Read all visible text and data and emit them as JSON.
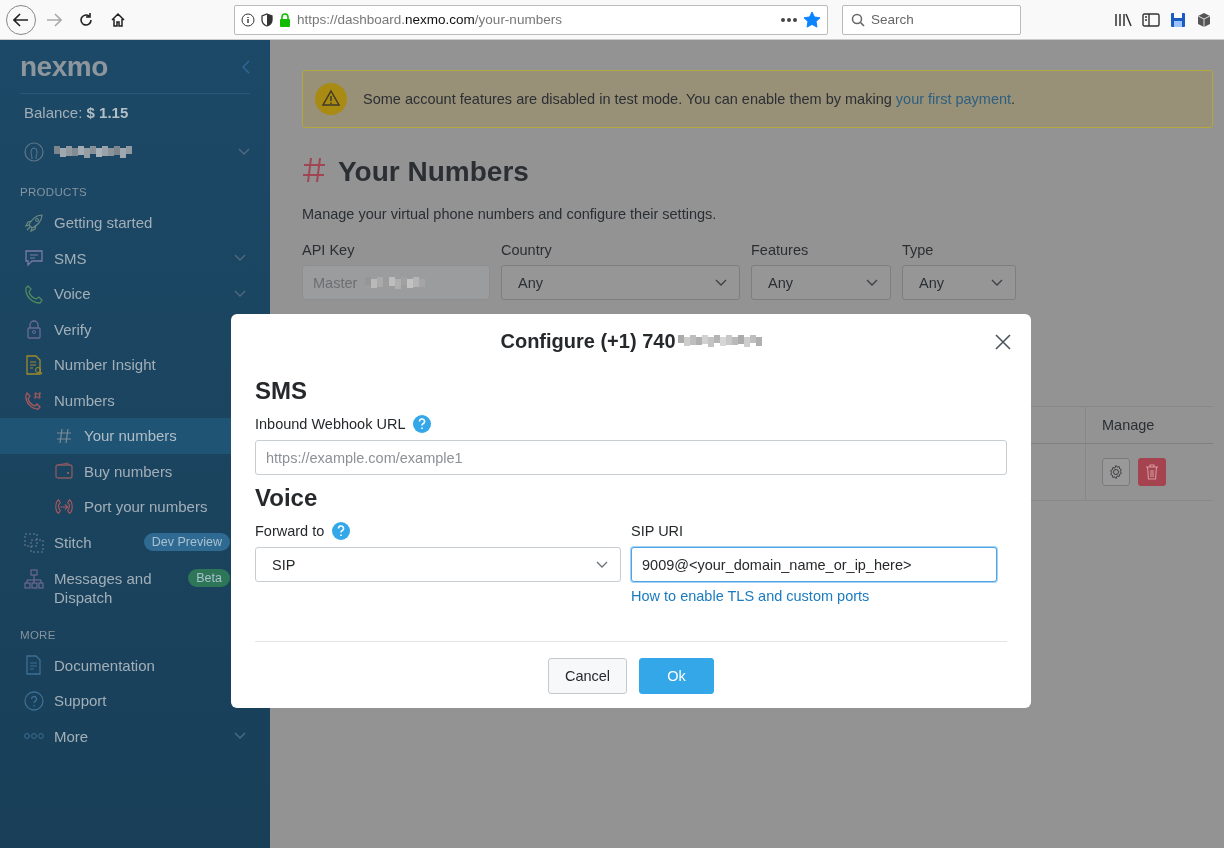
{
  "browser": {
    "url": {
      "prefix": "https://dashboard.",
      "domain": "nexmo.com",
      "path": "/your-numbers"
    },
    "search_placeholder": "Search",
    "back_disabled": false,
    "forward_disabled": true,
    "bookmarked": true
  },
  "sidebar": {
    "logo": "nexmo",
    "balance_label": "Balance:",
    "balance_value": "$ 1.15",
    "sections": [
      {
        "title": "PRODUCTS",
        "items": [
          {
            "label": "Getting started",
            "selected": false,
            "has_submenu": false
          },
          {
            "label": "SMS",
            "selected": false,
            "has_submenu": true
          },
          {
            "label": "Voice",
            "selected": false,
            "has_submenu": true
          },
          {
            "label": "Verify",
            "selected": false,
            "has_submenu": false
          },
          {
            "label": "Number Insight",
            "selected": false,
            "has_submenu": false
          },
          {
            "label": "Numbers",
            "selected": false,
            "has_submenu": false,
            "children": [
              {
                "label": "Your numbers",
                "selected": true
              },
              {
                "label": "Buy numbers",
                "selected": false
              },
              {
                "label": "Port your numbers",
                "selected": false
              }
            ]
          },
          {
            "label": "Stitch",
            "selected": false,
            "has_submenu": false,
            "badge": {
              "text": "Dev Preview",
              "color": "#2f6a92"
            }
          },
          {
            "label": "Messages and Dispatch",
            "selected": false,
            "has_submenu": false,
            "badge": {
              "text": "Beta",
              "color": "#2e7658"
            }
          }
        ]
      },
      {
        "title": "MORE",
        "items": [
          {
            "label": "Documentation",
            "selected": false,
            "has_submenu": false
          },
          {
            "label": "Support",
            "selected": false,
            "has_submenu": false
          },
          {
            "label": "More",
            "selected": false,
            "has_submenu": true
          }
        ]
      }
    ]
  },
  "banner": {
    "text_before": "Some account features are disabled in test mode. You can enable them by making ",
    "link": "your first payment",
    "text_after": "."
  },
  "page": {
    "title": "Your Numbers",
    "subtitle": "Manage your virtual phone numbers and configure their settings."
  },
  "filters": [
    {
      "kind": "text",
      "label": "API Key",
      "value": "Master",
      "disabled": true
    },
    {
      "kind": "select",
      "label": "Country",
      "value": "Any"
    },
    {
      "kind": "select",
      "label": "Features",
      "value": "Any"
    },
    {
      "kind": "select",
      "label": "Type",
      "value": "Any"
    }
  ],
  "table": {
    "columns": [
      "Manage"
    ]
  },
  "modal": {
    "title": "Configure (+1) 740",
    "sms_heading": "SMS",
    "webhook_label": "Inbound Webhook URL",
    "webhook_placeholder": "https://example.com/example1",
    "voice_heading": "Voice",
    "forward_label": "Forward to",
    "forward_value": "SIP",
    "sip_label": "SIP URI",
    "sip_value": "9009@<your_domain_name_or_ip_here>",
    "sip_focused": true,
    "help_link": "How to enable TLS and custom ports",
    "buttons": [
      {
        "label": "Cancel",
        "kind": "secondary"
      },
      {
        "label": "Ok",
        "kind": "primary"
      }
    ]
  }
}
